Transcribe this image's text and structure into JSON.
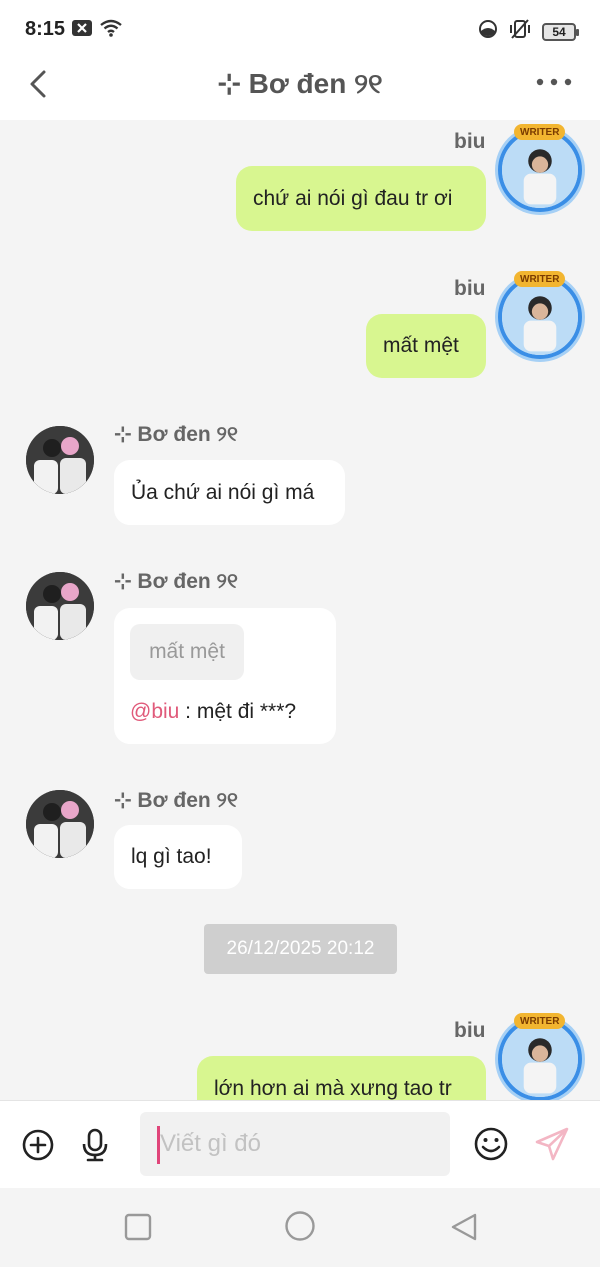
{
  "status": {
    "time": "8:15",
    "battery": "54"
  },
  "header": {
    "title": "⊹ Bơ đen ୨୧"
  },
  "messages": [
    {
      "sender": "biu",
      "direction": "out",
      "text": "chứ ai nói gì đau tr ơi"
    },
    {
      "sender": "biu",
      "direction": "out",
      "text": "mất mệt"
    },
    {
      "sender": "⊹ Bơ đen ୨୧",
      "direction": "in",
      "text": "Ủa chứ ai nói gì má"
    },
    {
      "sender": "⊹ Bơ đen ୨୧",
      "direction": "in",
      "quote": "mất mệt",
      "mention": "@biu",
      "text": " : mệt đi ***?"
    },
    {
      "sender": "⊹ Bơ đen ୨୧",
      "direction": "in",
      "text": "lq gì tao!"
    },
    {
      "sender": "biu",
      "direction": "out",
      "text": "lớn hơn ai mà xưng tao tr"
    }
  ],
  "timestamp": "26/12/2025 20:12",
  "avatar_badge": "WRITER",
  "input": {
    "placeholder": "Viết gì đó"
  },
  "icons": {
    "back": "chevron-left-icon",
    "more": "more-dots-icon",
    "add": "plus-circle-icon",
    "mic": "microphone-icon",
    "emoji": "emoji-icon",
    "send": "send-icon"
  },
  "colors": {
    "outgoing_bubble": "#d8f690",
    "incoming_bubble": "#ffffff",
    "mention": "#e05a7a",
    "send_icon": "#f3b6c4",
    "caret": "#e0457a"
  }
}
